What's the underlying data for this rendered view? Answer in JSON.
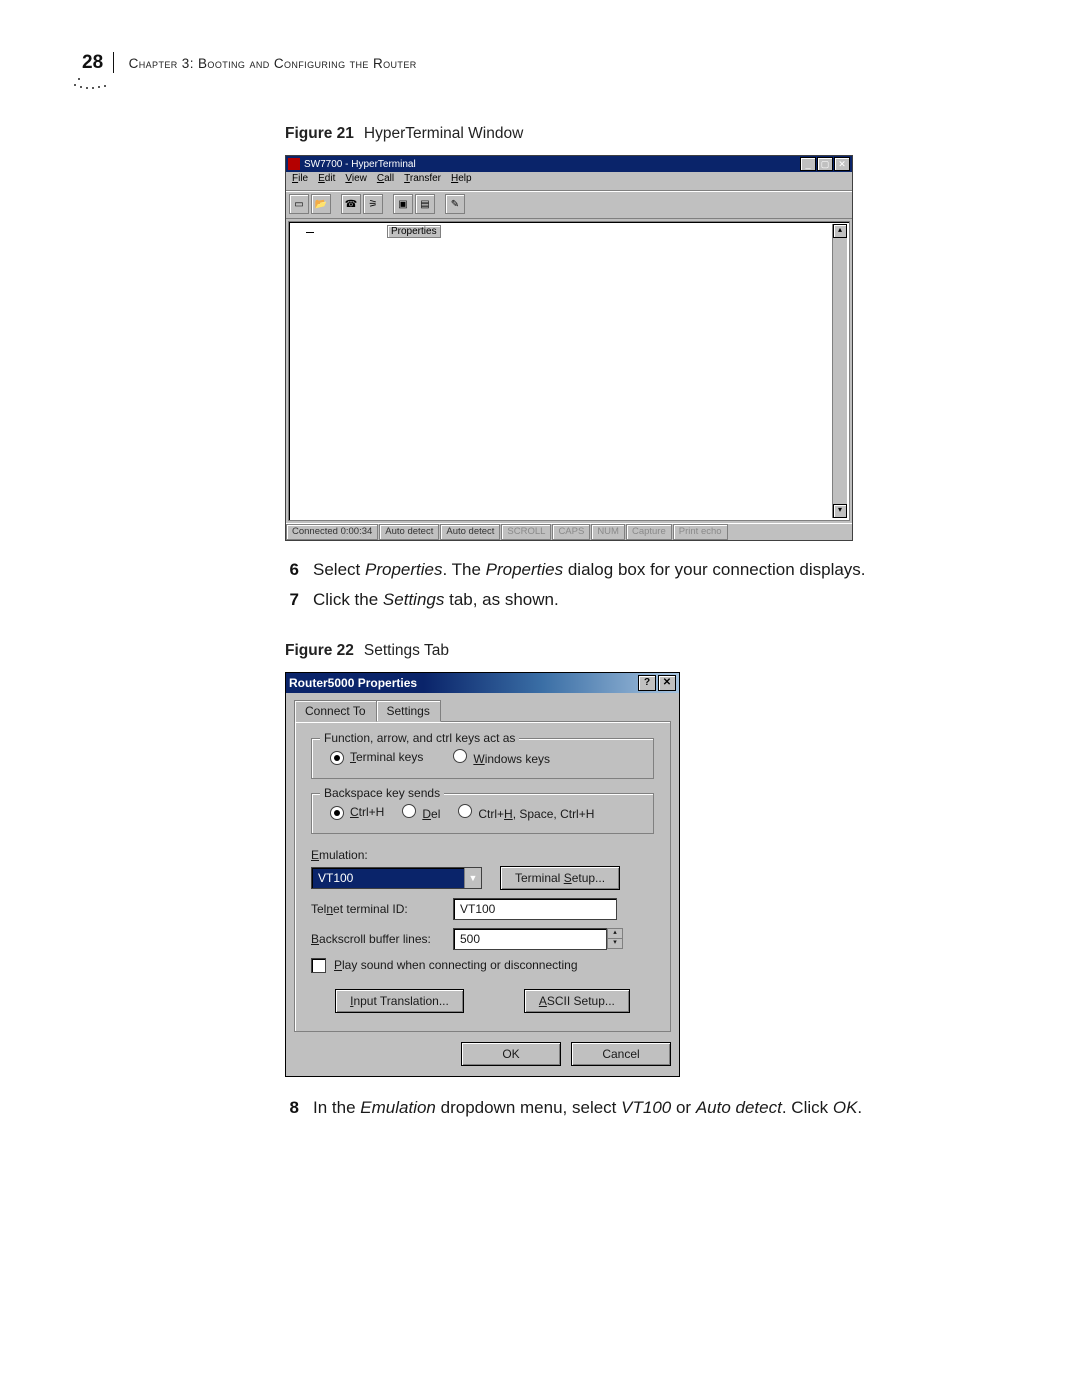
{
  "header": {
    "page": "28",
    "chapter_prefix": "Chapter 3:",
    "chapter_title": "Booting and Configuring the Router"
  },
  "fig1": {
    "caption_label": "Figure 21",
    "caption_text": "HyperTerminal Window",
    "window_title": "SW7700 - HyperTerminal",
    "menu": [
      "ile",
      "dit",
      "iew",
      "all",
      "ransfer",
      "elp"
    ],
    "tooltip": "Properties",
    "status": [
      "Connected 0:00:34",
      "Auto detect",
      "Auto detect",
      "SCROLL",
      "CAPS",
      "NUM",
      "Capture",
      "Print echo"
    ]
  },
  "steps": [
    {
      "num": "6",
      "i1": "Properties",
      "i2": "Properties",
      "tail": "dialog box for your connection displays."
    },
    {
      "num": "7",
      "pre": "Click the",
      "i1": "Settings",
      "tail": "tab, as shown."
    },
    {
      "num": "8",
      "pre": "In the",
      "i1": "Emulation",
      "mid1": "dropdown menu, select",
      "i2": "VT100",
      "mid2": "or",
      "i3": "Auto detect",
      "mid3": ". Click",
      "i4": "OK"
    }
  ],
  "fig2": {
    "caption_label": "Figure 22",
    "caption_text": "Settings Tab",
    "title": "Router5000 Properties",
    "tabs": [
      "Connect To",
      "Settings"
    ],
    "group1": {
      "legend": "Function, arrow, and ctrl keys act as",
      "opt1": "erminal keys",
      "opt2": "indows keys"
    },
    "group2": {
      "legend": "Backspace key sends",
      "opt1": "trl+H",
      "opt2": "el",
      "opt3a": "Ctrl+",
      "opt3b": ", Space, Ctrl+H"
    },
    "emulation_label": "mulation:",
    "emulation_value": "VT100",
    "terminal_setup_tail": "etup...",
    "telnet_label_tail": "et terminal ID:",
    "telnet_value": "VT100",
    "backscroll_label_tail": "ackscroll buffer lines:",
    "backscroll_value": "500",
    "playsound_tail": "lay sound when connecting or disconnecting",
    "input_trans_tail": "nput Translation...",
    "ascii_setup_tail": "SCII Setup...",
    "ok": "OK",
    "cancel": "Cancel"
  }
}
